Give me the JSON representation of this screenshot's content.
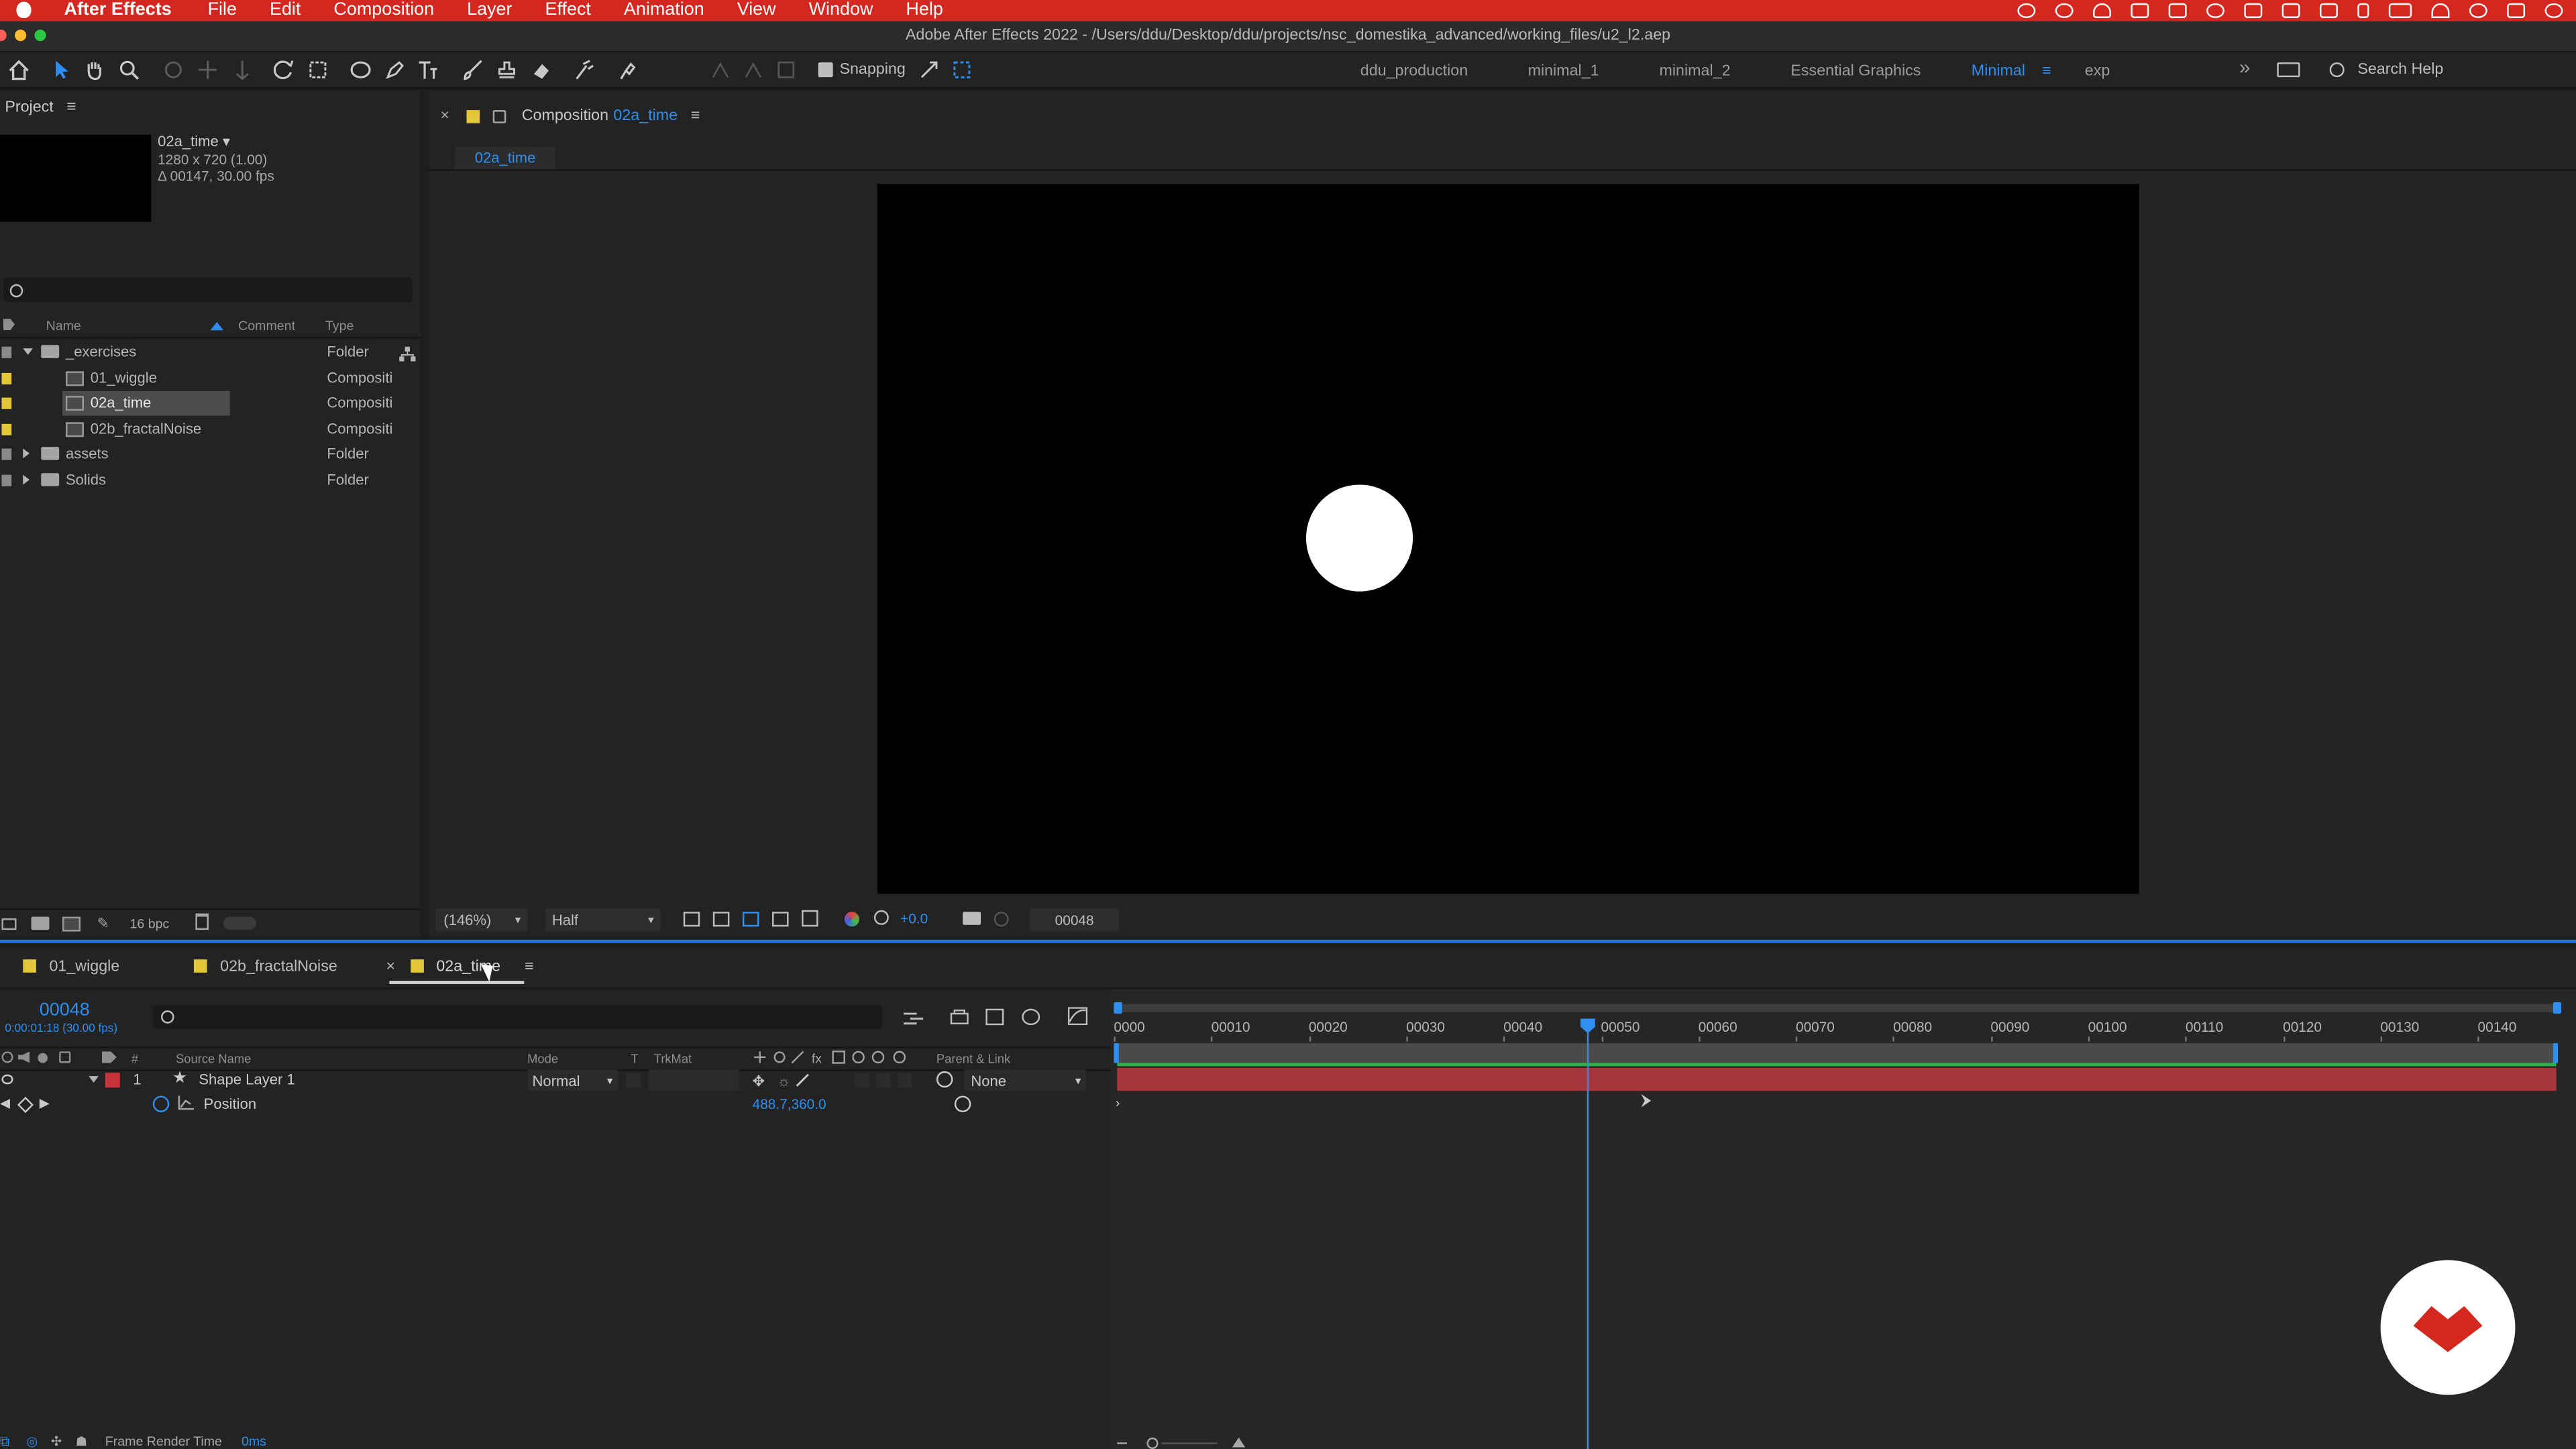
{
  "menubar": {
    "app": "After Effects",
    "items": [
      "File",
      "Edit",
      "Composition",
      "Layer",
      "Effect",
      "Animation",
      "View",
      "Window",
      "Help"
    ]
  },
  "window": {
    "title": "Adobe After Effects 2022 - /Users/ddu/Desktop/ddu/projects/nsc_domestika_advanced/working_files/u2_l2.aep"
  },
  "toolbar": {
    "snapping_label": "Snapping",
    "workspaces": [
      "ddu_production",
      "minimal_1",
      "minimal_2",
      "Essential Graphics",
      "Minimal",
      "exp"
    ],
    "active_workspace": "Minimal",
    "search_placeholder": "Search Help"
  },
  "project": {
    "panel_title": "Project",
    "selected_item": {
      "name": "02a_time",
      "size": "1280 x 720 (1.00)",
      "duration": "Δ 00147, 30.00 fps"
    },
    "search_value": "",
    "columns": {
      "name": "Name",
      "comment": "Comment",
      "type": "Type"
    },
    "items": [
      {
        "name": "_exercises",
        "type": "Folder",
        "kind": "folder",
        "expanded": true,
        "indent": 0
      },
      {
        "name": "01_wiggle",
        "type": "Compositi",
        "kind": "comp",
        "indent": 1
      },
      {
        "name": "02a_time",
        "type": "Compositi",
        "kind": "comp",
        "indent": 1,
        "selected": true
      },
      {
        "name": "02b_fractalNoise",
        "type": "Compositi",
        "kind": "comp",
        "indent": 1
      },
      {
        "name": "assets",
        "type": "Folder",
        "kind": "folder",
        "indent": 0
      },
      {
        "name": "Solids",
        "type": "Folder",
        "kind": "folder",
        "indent": 0
      }
    ],
    "bpc": "16 bpc"
  },
  "composition": {
    "panel_prefix": "Composition",
    "comp_name": "02a_time",
    "flowchart_tab": "02a_time",
    "zoom": "(146%)",
    "resolution": "Half",
    "exposure": "+0.0",
    "timecode": "00048"
  },
  "timeline": {
    "tabs": [
      "01_wiggle",
      "02b_fractalNoise",
      "02a_time"
    ],
    "active_tab": "02a_time",
    "current_time": "00048",
    "current_time_sub": "0:00:01:18 (30.00 fps)",
    "columns": {
      "source": "Source Name",
      "mode": "Mode",
      "t": "T",
      "trkmat": "TrkMat",
      "parent": "Parent & Link",
      "num": "#"
    },
    "layers": [
      {
        "index": "1",
        "name": "Shape Layer 1",
        "mode": "Normal",
        "parent": "None"
      }
    ],
    "property": {
      "name": "Position",
      "value": "488.7,360.0"
    },
    "ruler_ticks": [
      "0000",
      "00010",
      "00020",
      "00030",
      "00040",
      "00050",
      "00060",
      "00070",
      "00080",
      "00090",
      "00100",
      "00110",
      "00120",
      "00130",
      "00140"
    ],
    "frame_render_label": "Frame Render Time",
    "frame_render_value": "0ms"
  },
  "colors": {
    "accent_blue": "#2e8ff0",
    "menubar_red": "#d3271f",
    "layer_bar": "#a6363d",
    "label_yellow": "#e2c838",
    "work_area_green": "#2fb04a"
  }
}
